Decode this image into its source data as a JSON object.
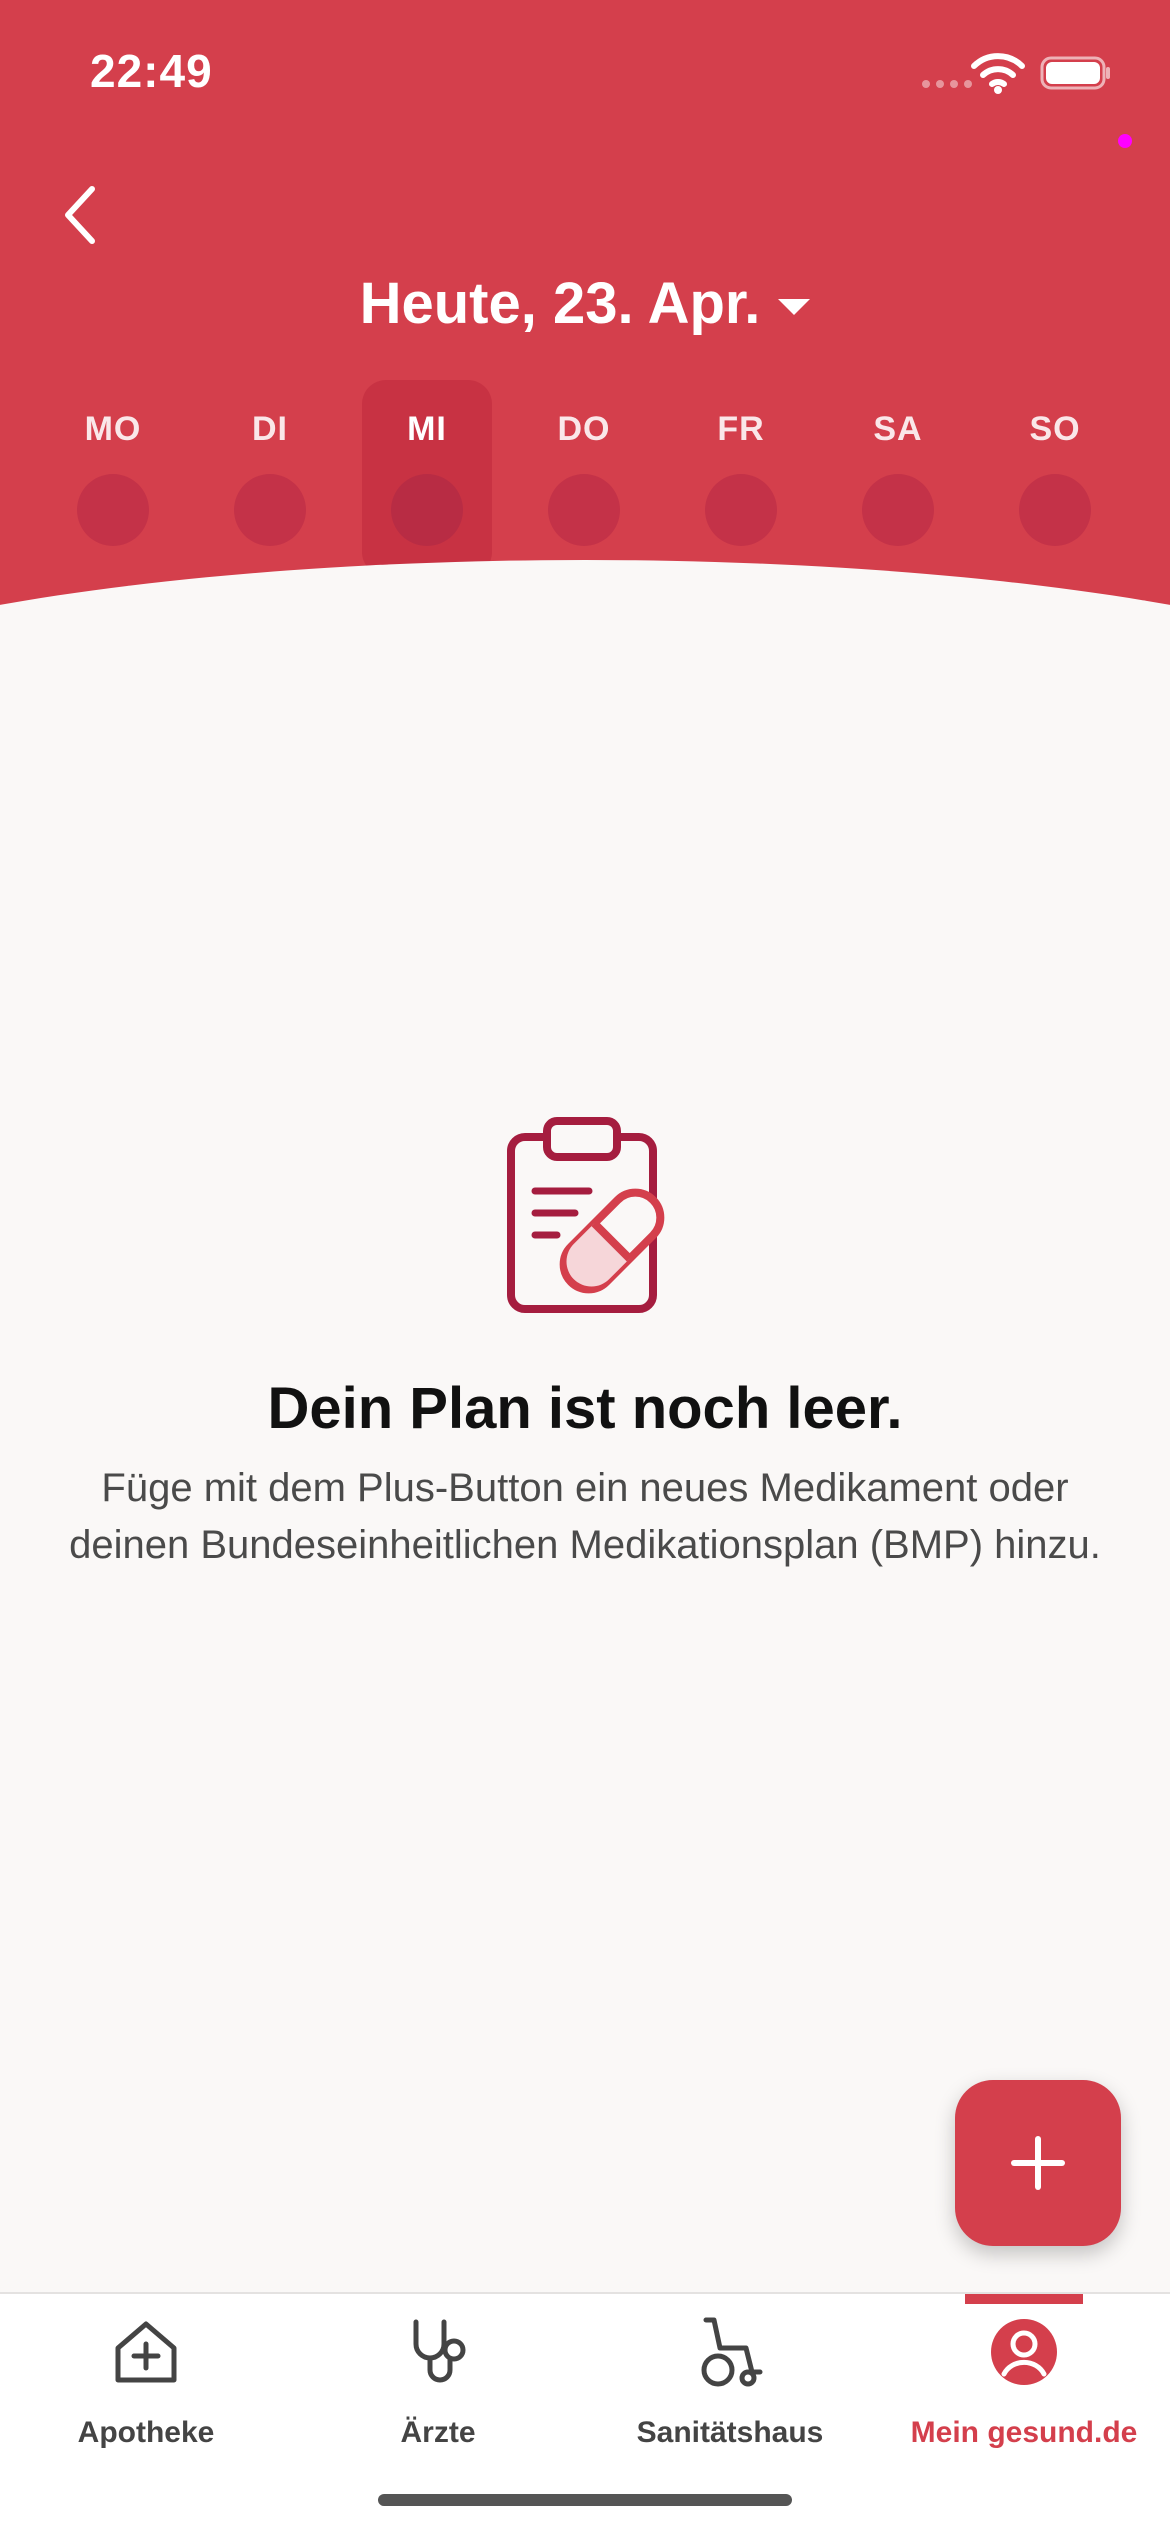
{
  "status_bar": {
    "time": "22:49"
  },
  "header": {
    "date_title": "Heute, 23. Apr.",
    "days": [
      {
        "label": "MO",
        "selected": false
      },
      {
        "label": "DI",
        "selected": false
      },
      {
        "label": "MI",
        "selected": true
      },
      {
        "label": "DO",
        "selected": false
      },
      {
        "label": "FR",
        "selected": false
      },
      {
        "label": "SA",
        "selected": false
      },
      {
        "label": "SO",
        "selected": false
      }
    ]
  },
  "empty_state": {
    "icon": "clipboard-pill-icon",
    "title": "Dein Plan ist noch leer.",
    "text": "Füge mit dem Plus-Button ein neues Medikament oder deinen Bundeseinheitlichen Medikationsplan (BMP) hinzu."
  },
  "fab": {
    "icon": "plus-icon"
  },
  "bottom_nav": {
    "items": [
      {
        "label": "Apotheke",
        "icon": "house-plus-icon",
        "active": false
      },
      {
        "label": "Ärzte",
        "icon": "stethoscope-icon",
        "active": false
      },
      {
        "label": "Sanitätshaus",
        "icon": "wheelchair-icon",
        "active": false
      },
      {
        "label": "Mein gesund.de",
        "icon": "user-icon",
        "active": true
      }
    ]
  },
  "colors": {
    "primary": "#d43f4c",
    "background": "#faf8f7",
    "icon_dark": "#a51d3f"
  }
}
